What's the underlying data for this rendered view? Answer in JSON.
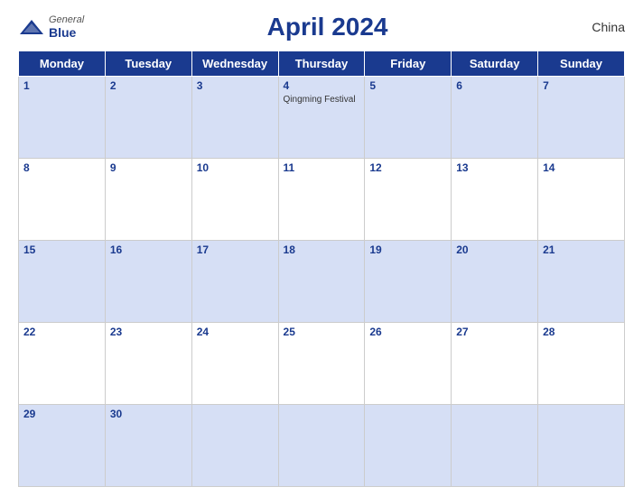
{
  "header": {
    "logo_general": "General",
    "logo_blue": "Blue",
    "title": "April 2024",
    "country": "China"
  },
  "calendar": {
    "weekdays": [
      "Monday",
      "Tuesday",
      "Wednesday",
      "Thursday",
      "Friday",
      "Saturday",
      "Sunday"
    ],
    "weeks": [
      [
        {
          "day": "1",
          "event": ""
        },
        {
          "day": "2",
          "event": ""
        },
        {
          "day": "3",
          "event": ""
        },
        {
          "day": "4",
          "event": "Qingming Festival"
        },
        {
          "day": "5",
          "event": ""
        },
        {
          "day": "6",
          "event": ""
        },
        {
          "day": "7",
          "event": ""
        }
      ],
      [
        {
          "day": "8",
          "event": ""
        },
        {
          "day": "9",
          "event": ""
        },
        {
          "day": "10",
          "event": ""
        },
        {
          "day": "11",
          "event": ""
        },
        {
          "day": "12",
          "event": ""
        },
        {
          "day": "13",
          "event": ""
        },
        {
          "day": "14",
          "event": ""
        }
      ],
      [
        {
          "day": "15",
          "event": ""
        },
        {
          "day": "16",
          "event": ""
        },
        {
          "day": "17",
          "event": ""
        },
        {
          "day": "18",
          "event": ""
        },
        {
          "day": "19",
          "event": ""
        },
        {
          "day": "20",
          "event": ""
        },
        {
          "day": "21",
          "event": ""
        }
      ],
      [
        {
          "day": "22",
          "event": ""
        },
        {
          "day": "23",
          "event": ""
        },
        {
          "day": "24",
          "event": ""
        },
        {
          "day": "25",
          "event": ""
        },
        {
          "day": "26",
          "event": ""
        },
        {
          "day": "27",
          "event": ""
        },
        {
          "day": "28",
          "event": ""
        }
      ],
      [
        {
          "day": "29",
          "event": ""
        },
        {
          "day": "30",
          "event": ""
        },
        {
          "day": "",
          "event": ""
        },
        {
          "day": "",
          "event": ""
        },
        {
          "day": "",
          "event": ""
        },
        {
          "day": "",
          "event": ""
        },
        {
          "day": "",
          "event": ""
        }
      ]
    ]
  }
}
